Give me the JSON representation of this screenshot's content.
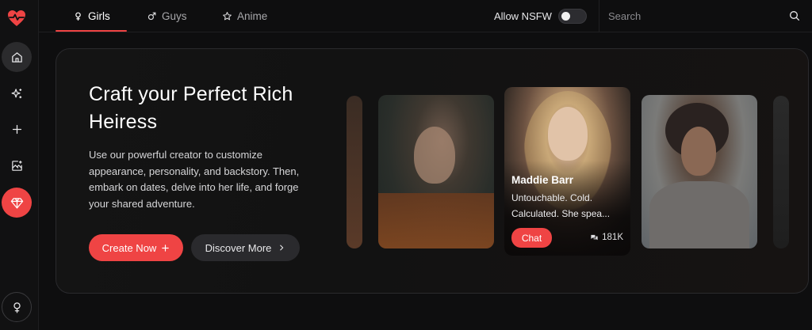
{
  "colors": {
    "accent": "#ef4444",
    "background": "#0e0e0f"
  },
  "sidebar": {
    "logo_icon": "heart-pulse-icon",
    "items": [
      {
        "icon": "home-icon",
        "active": true
      },
      {
        "icon": "sparkles-icon"
      },
      {
        "icon": "plus-icon"
      },
      {
        "icon": "image-sparkle-icon"
      },
      {
        "icon": "gem-icon",
        "premium": true
      },
      {
        "icon": "female-icon"
      }
    ]
  },
  "tabs": [
    {
      "label": "Girls",
      "icon": "female-icon",
      "active": true
    },
    {
      "label": "Guys",
      "icon": "male-icon"
    },
    {
      "label": "Anime",
      "icon": "star-icon"
    }
  ],
  "nsfw": {
    "label": "Allow NSFW",
    "enabled": false
  },
  "search": {
    "placeholder": "Search"
  },
  "hero": {
    "title": "Craft your Perfect Rich Heiress",
    "description": "Use our powerful creator to customize appearance, personality, and backstory. Then, embark on dates, delve into her life, and forge your shared adventure.",
    "create_label": "Create Now",
    "discover_label": "Discover More"
  },
  "featured": {
    "name": "Maddie Barr",
    "bio": "Untouchable. Cold. Calculated. She spea...",
    "chat_label": "Chat",
    "count": "181K"
  }
}
